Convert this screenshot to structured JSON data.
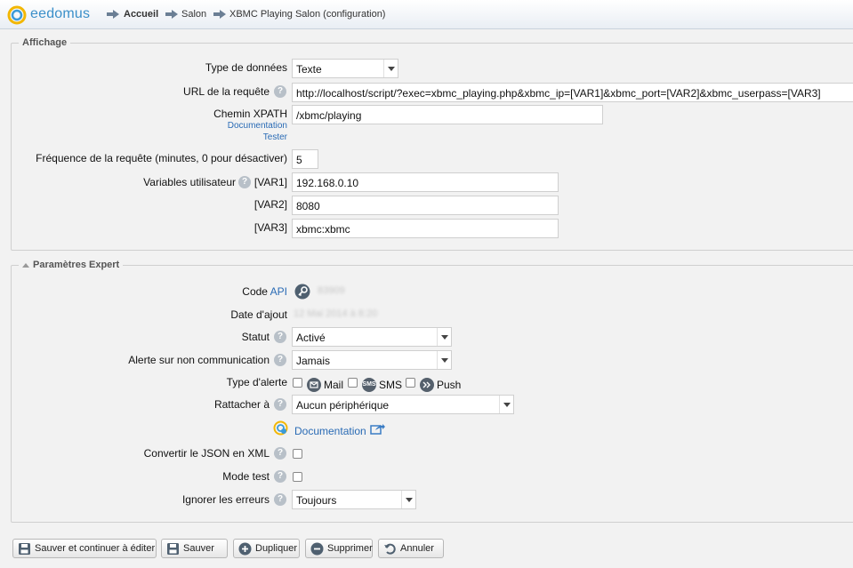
{
  "header": {
    "logo_text": "eedomus",
    "breadcrumb": [
      "Accueil",
      "Salon",
      "XBMC Playing Salon (configuration)"
    ]
  },
  "affichage": {
    "legend": "Affichage",
    "type_label": "Type de données",
    "type_value": "Texte",
    "url_label": "URL de la requête",
    "url_value": "http://localhost/script/?exec=xbmc_playing.php&xbmc_ip=[VAR1]&xbmc_port=[VAR2]&xbmc_userpass=[VAR3]",
    "xpath_label": "Chemin XPATH",
    "xpath_doc": "Documentation",
    "xpath_test": "Tester",
    "xpath_value": "/xbmc/playing",
    "freq_label": "Fréquence de la requête (minutes, 0 pour désactiver)",
    "freq_value": "5",
    "vars_label": "Variables utilisateur",
    "var1_label": "[VAR1]",
    "var1_value": "192.168.0.10",
    "var2_label": "[VAR2]",
    "var2_value": "8080",
    "var3_label": "[VAR3]",
    "var3_value": "xbmc:xbmc"
  },
  "expert": {
    "legend": "Paramètres Expert",
    "code_label": "Code",
    "code_api": "API",
    "code_value": "83909",
    "date_label": "Date d'ajout",
    "date_value": "12 Mai 2014 à 8:20",
    "statut_label": "Statut",
    "statut_value": "Activé",
    "alerte_label": "Alerte sur non communication",
    "alerte_value": "Jamais",
    "type_alerte_label": "Type d'alerte",
    "type_alerte_options": [
      {
        "label": "Mail",
        "icon_text": "",
        "checked": false
      },
      {
        "label": "SMS",
        "icon_text": "SMS",
        "checked": false
      },
      {
        "label": "Push",
        "icon_text": "",
        "checked": false
      }
    ],
    "rattacher_label": "Rattacher à",
    "rattacher_value": "Aucun périphérique",
    "documentation_link": "Documentation",
    "json_label": "Convertir le JSON en XML",
    "mode_test_label": "Mode test",
    "ignorer_label": "Ignorer les erreurs",
    "ignorer_value": "Toujours"
  },
  "buttons": {
    "save_continue": "Sauver et continuer à éditer",
    "save": "Sauver",
    "duplicate": "Dupliquer",
    "delete": "Supprimer",
    "cancel": "Annuler"
  }
}
